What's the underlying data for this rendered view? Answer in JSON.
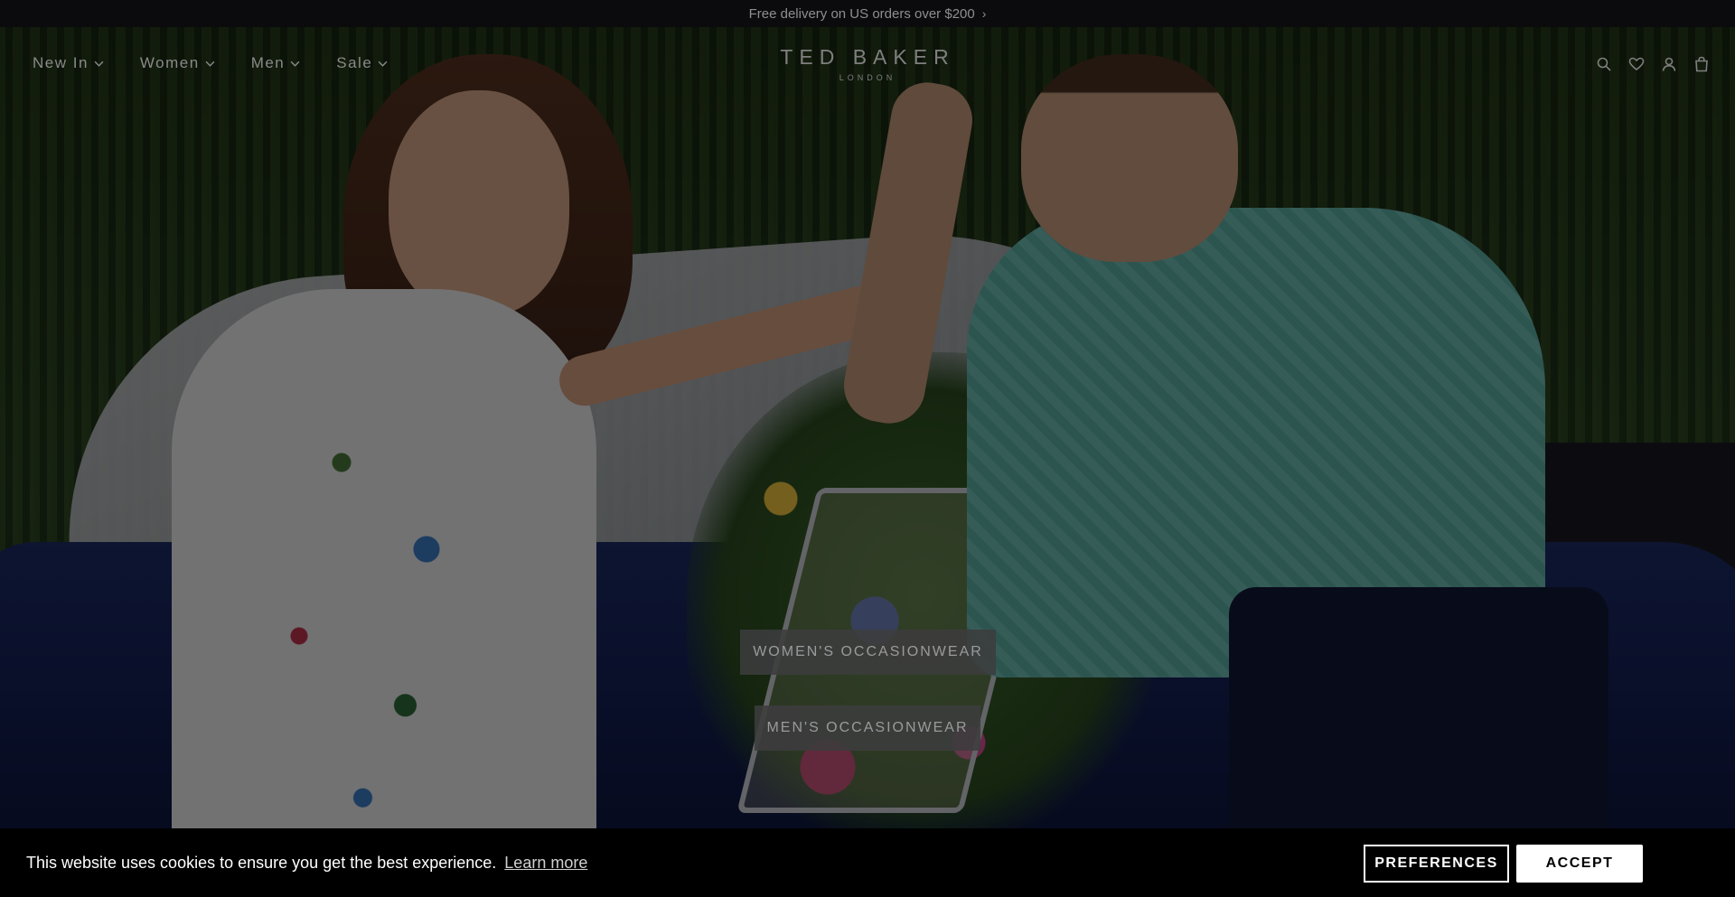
{
  "announcement": {
    "text": "Free delivery on US orders over $200",
    "chevron": "›"
  },
  "header": {
    "nav": [
      {
        "label": "New In"
      },
      {
        "label": "Women"
      },
      {
        "label": "Men"
      },
      {
        "label": "Sale"
      }
    ],
    "brand": {
      "name": "TED BAKER",
      "sub": "LONDON"
    },
    "icons": [
      "search-icon",
      "heart-icon",
      "account-icon",
      "bag-icon"
    ]
  },
  "hero": {
    "cta_women": "WOMEN'S OCCASIONWEAR",
    "cta_men": "MEN'S OCCASIONWEAR"
  },
  "cookie": {
    "message": "This website uses cookies to ensure you get the best experience.",
    "learn_more": "Learn more",
    "preferences": "PREFERENCES",
    "accept": "ACCEPT"
  },
  "colors": {
    "overlay": "#000000",
    "banner_bg": "#000000",
    "accept_bg": "#ffffff"
  }
}
